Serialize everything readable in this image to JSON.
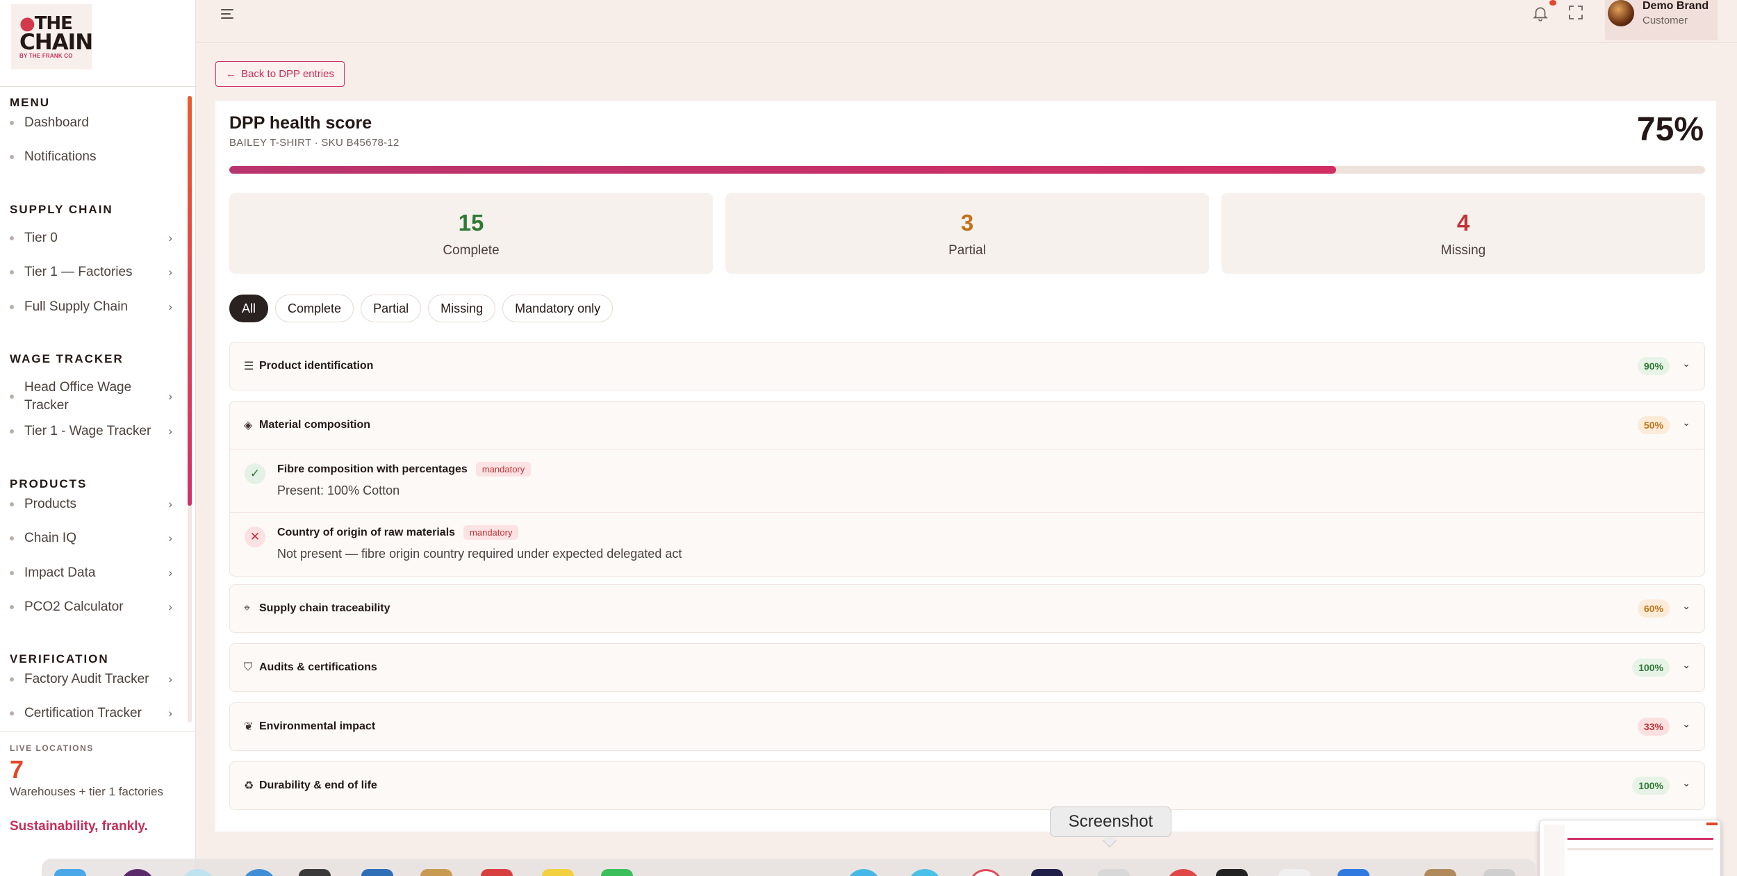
{
  "logo": {
    "line1": "THE",
    "line2": "CHAIN",
    "line3": "BY THE FRANK CO"
  },
  "sidebar": {
    "sections": [
      {
        "title": "MENU",
        "items": [
          {
            "label": "Dashboard",
            "has_chevron": false
          },
          {
            "label": "Notifications",
            "has_chevron": false
          }
        ]
      },
      {
        "title": "SUPPLY CHAIN",
        "items": [
          {
            "label": "Tier 0",
            "has_chevron": true
          },
          {
            "label": "Tier 1 — Factories",
            "has_chevron": true
          },
          {
            "label": "Full Supply Chain",
            "has_chevron": true
          }
        ]
      },
      {
        "title": "WAGE TRACKER",
        "items": [
          {
            "label": "Head Office Wage Tracker",
            "has_chevron": true
          },
          {
            "label": "Tier 1 - Wage Tracker",
            "has_chevron": true
          }
        ]
      },
      {
        "title": "PRODUCTS",
        "items": [
          {
            "label": "Products",
            "has_chevron": true
          },
          {
            "label": "Chain IQ",
            "has_chevron": true
          },
          {
            "label": "Impact Data",
            "has_chevron": true
          },
          {
            "label": "PCO2 Calculator",
            "has_chevron": true
          }
        ]
      },
      {
        "title": "VERIFICATION",
        "items": [
          {
            "label": "Factory Audit Tracker",
            "has_chevron": true
          },
          {
            "label": "Certification Tracker",
            "has_chevron": true
          }
        ]
      }
    ],
    "live": {
      "caption": "LIVE LOCATIONS",
      "count": "7",
      "description": "Warehouses + tier 1 factories"
    },
    "tagline": "Sustainability, frankly."
  },
  "topbar": {
    "user_name": "Demo Brand",
    "user_role": "Customer",
    "icons": [
      "menu-icon",
      "bell-icon",
      "fullscreen-icon"
    ]
  },
  "main": {
    "back_label": "Back to DPP entries",
    "title": "DPP health score",
    "subtitle": "BAILEY T-SHIRT · SKU B45678-12",
    "score": "75%",
    "score_fraction": 0.75,
    "stats": [
      {
        "value": "15",
        "label": "Complete",
        "color": "#2f7a34"
      },
      {
        "value": "3",
        "label": "Partial",
        "color": "#c0731a"
      },
      {
        "value": "4",
        "label": "Missing",
        "color": "#c23236"
      }
    ],
    "filters": [
      "All",
      "Complete",
      "Partial",
      "Missing",
      "Mandatory only"
    ],
    "active_filter": "All",
    "sections": [
      {
        "icon": "list-icon",
        "title": "Product identification",
        "pct": "90%",
        "tone": "g"
      },
      {
        "icon": "layers-icon",
        "title": "Material composition",
        "pct": "50%",
        "tone": "o",
        "expanded": true,
        "rows": [
          {
            "status": "present",
            "label": "Fibre composition with percentages",
            "badge": "mandatory",
            "value": "Present: 100% Cotton"
          },
          {
            "status": "missing",
            "label": "Country of origin of raw materials",
            "badge": "mandatory",
            "value": "Not present — fibre origin country required under expected delegated act"
          }
        ]
      },
      {
        "icon": "pin-icon",
        "title": "Supply chain traceability",
        "pct": "60%",
        "tone": "o"
      },
      {
        "icon": "shield-check-icon",
        "title": "Audits & certifications",
        "pct": "100%",
        "tone": "g"
      },
      {
        "icon": "leaf-icon",
        "title": "Environmental impact",
        "pct": "33%",
        "tone": "r"
      },
      {
        "icon": "recycle-icon",
        "title": "Durability & end of life",
        "pct": "100%",
        "tone": "g"
      }
    ]
  },
  "tooltip": "Screenshot"
}
